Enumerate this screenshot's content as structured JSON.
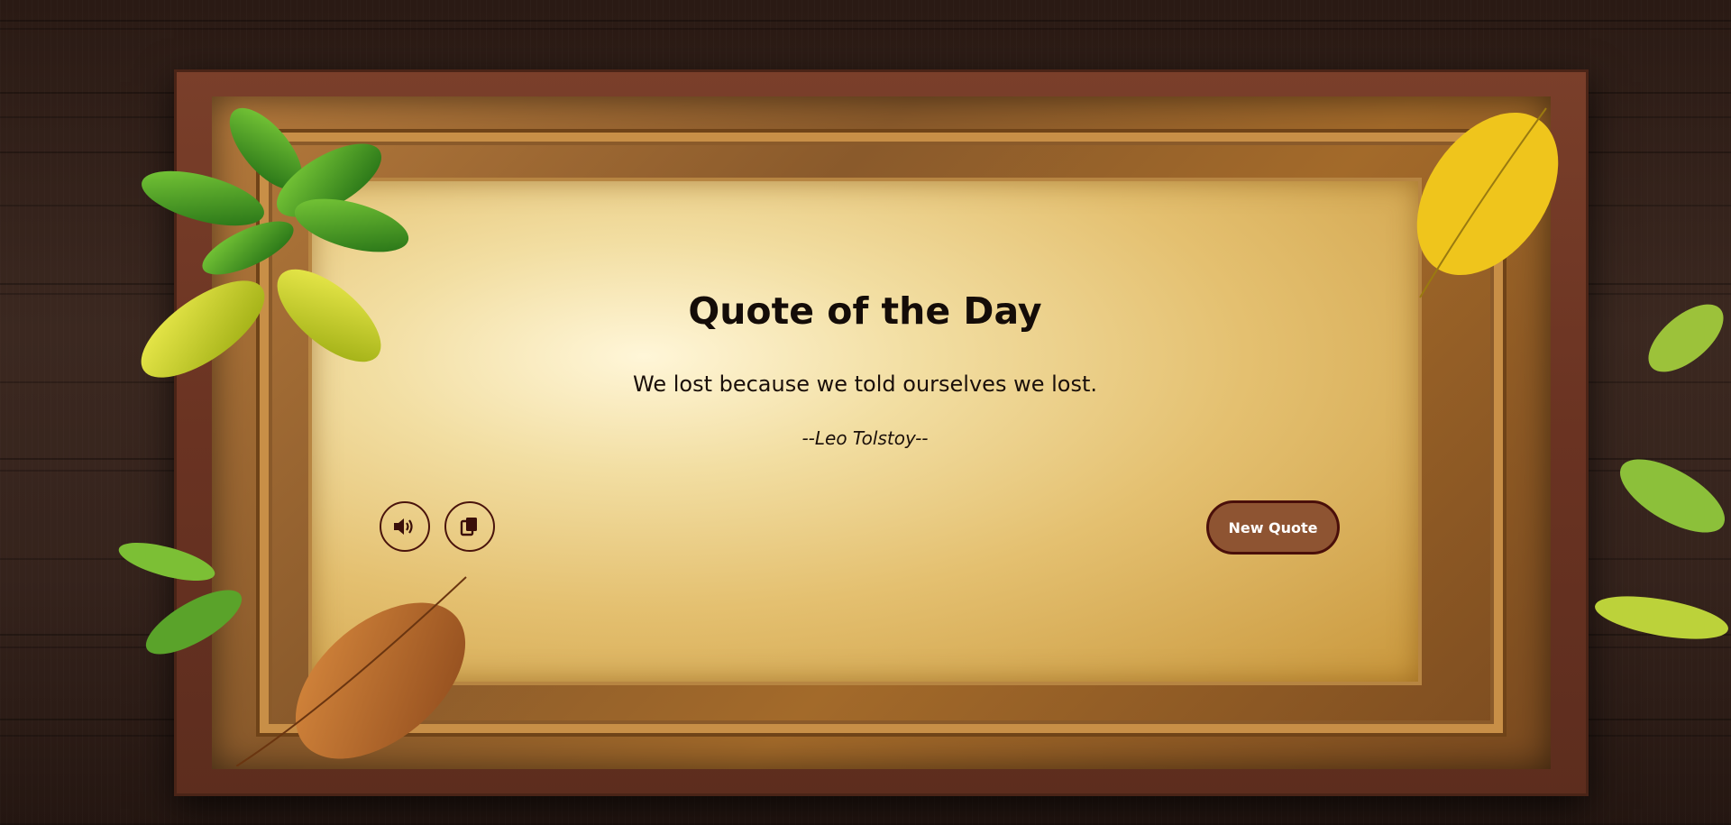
{
  "quote_card": {
    "title": "Quote of the Day",
    "quote": "We lost because we told ourselves we lost.",
    "author": "--Leo Tolstoy--"
  },
  "controls": {
    "speak_icon": "speaker-icon",
    "copy_icon": "copy-icon",
    "new_quote_label": "New Quote"
  },
  "colors": {
    "button_fill": "#8e5432",
    "button_border": "#4a0f0a",
    "text": "#140c08"
  }
}
